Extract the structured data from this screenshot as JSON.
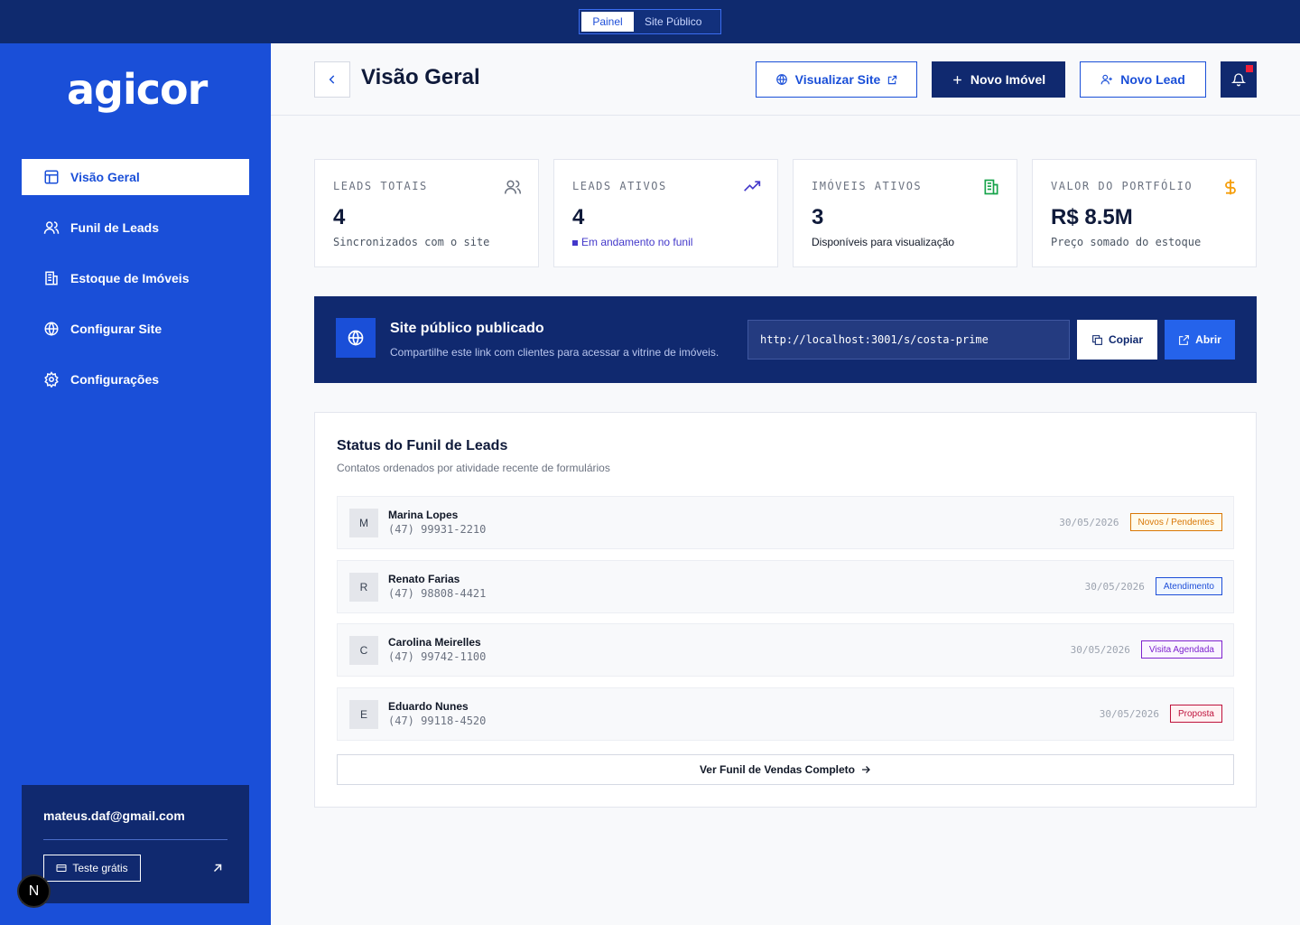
{
  "topbar": {
    "tabs": [
      {
        "label": "Painel",
        "active": true
      },
      {
        "label": "Site Público",
        "active": false
      }
    ]
  },
  "sidebar": {
    "logo": "agicor",
    "items": [
      {
        "label": "Visão Geral",
        "icon": "layout-icon",
        "active": true
      },
      {
        "label": "Funil de Leads",
        "icon": "users-icon",
        "active": false
      },
      {
        "label": "Estoque de Imóveis",
        "icon": "building-icon",
        "active": false
      },
      {
        "label": "Configurar Site",
        "icon": "globe-icon",
        "active": false
      },
      {
        "label": "Configurações",
        "icon": "gear-icon",
        "active": false
      }
    ],
    "account": {
      "email": "mateus.daf@gmail.com",
      "trial_label": "Teste grátis"
    },
    "badge": "N"
  },
  "header": {
    "title": "Visão Geral",
    "view_site_label": "Visualizar Site",
    "new_property_label": "Novo Imóvel",
    "new_lead_label": "Novo Lead"
  },
  "stats": [
    {
      "label": "LEADS TOTAIS",
      "value": "4",
      "sub": "Sincronizados com o site",
      "icon": "users-icon",
      "color": "#6b7280"
    },
    {
      "label": "LEADS ATIVOS",
      "value": "4",
      "sub": "Em andamento no funil",
      "icon": "trending-up-icon",
      "color": "#4338ca"
    },
    {
      "label": "IMÓVEIS ATIVOS",
      "value": "3",
      "sub": "Disponíveis para visualização",
      "icon": "building-icon",
      "color": "#16a34a"
    },
    {
      "label": "VALOR DO PORTFÓLIO",
      "value": "R$ 8.5M",
      "sub": "Preço somado do estoque",
      "icon": "dollar-icon",
      "color": "#f59e0b"
    }
  ],
  "publish": {
    "title": "Site público publicado",
    "subtitle": "Compartilhe este link com clientes para acessar a vitrine de imóveis.",
    "url": "http://localhost:3001/s/costa-prime",
    "copy_label": "Copiar",
    "open_label": "Abrir"
  },
  "funnel": {
    "title": "Status do Funil de Leads",
    "subtitle": "Contatos ordenados por atividade recente de formulários",
    "leads": [
      {
        "initial": "M",
        "name": "Marina Lopes",
        "phone": "(47) 99931-2210",
        "date": "30/05/2026",
        "status": "Novos / Pendentes",
        "status_color": "#d97706",
        "status_bg": "#fffbeb"
      },
      {
        "initial": "R",
        "name": "Renato Farias",
        "phone": "(47) 98808-4421",
        "date": "30/05/2026",
        "status": "Atendimento",
        "status_color": "#1d4ed8",
        "status_bg": "#eff6ff"
      },
      {
        "initial": "C",
        "name": "Carolina Meirelles",
        "phone": "(47) 99742-1100",
        "date": "30/05/2026",
        "status": "Visita Agendada",
        "status_color": "#7e22ce",
        "status_bg": "#faf5ff"
      },
      {
        "initial": "E",
        "name": "Eduardo Nunes",
        "phone": "(47) 99118-4520",
        "date": "30/05/2026",
        "status": "Proposta",
        "status_color": "#be123c",
        "status_bg": "#fff1f2"
      }
    ],
    "full_button_label": "Ver Funil de Vendas Completo"
  }
}
